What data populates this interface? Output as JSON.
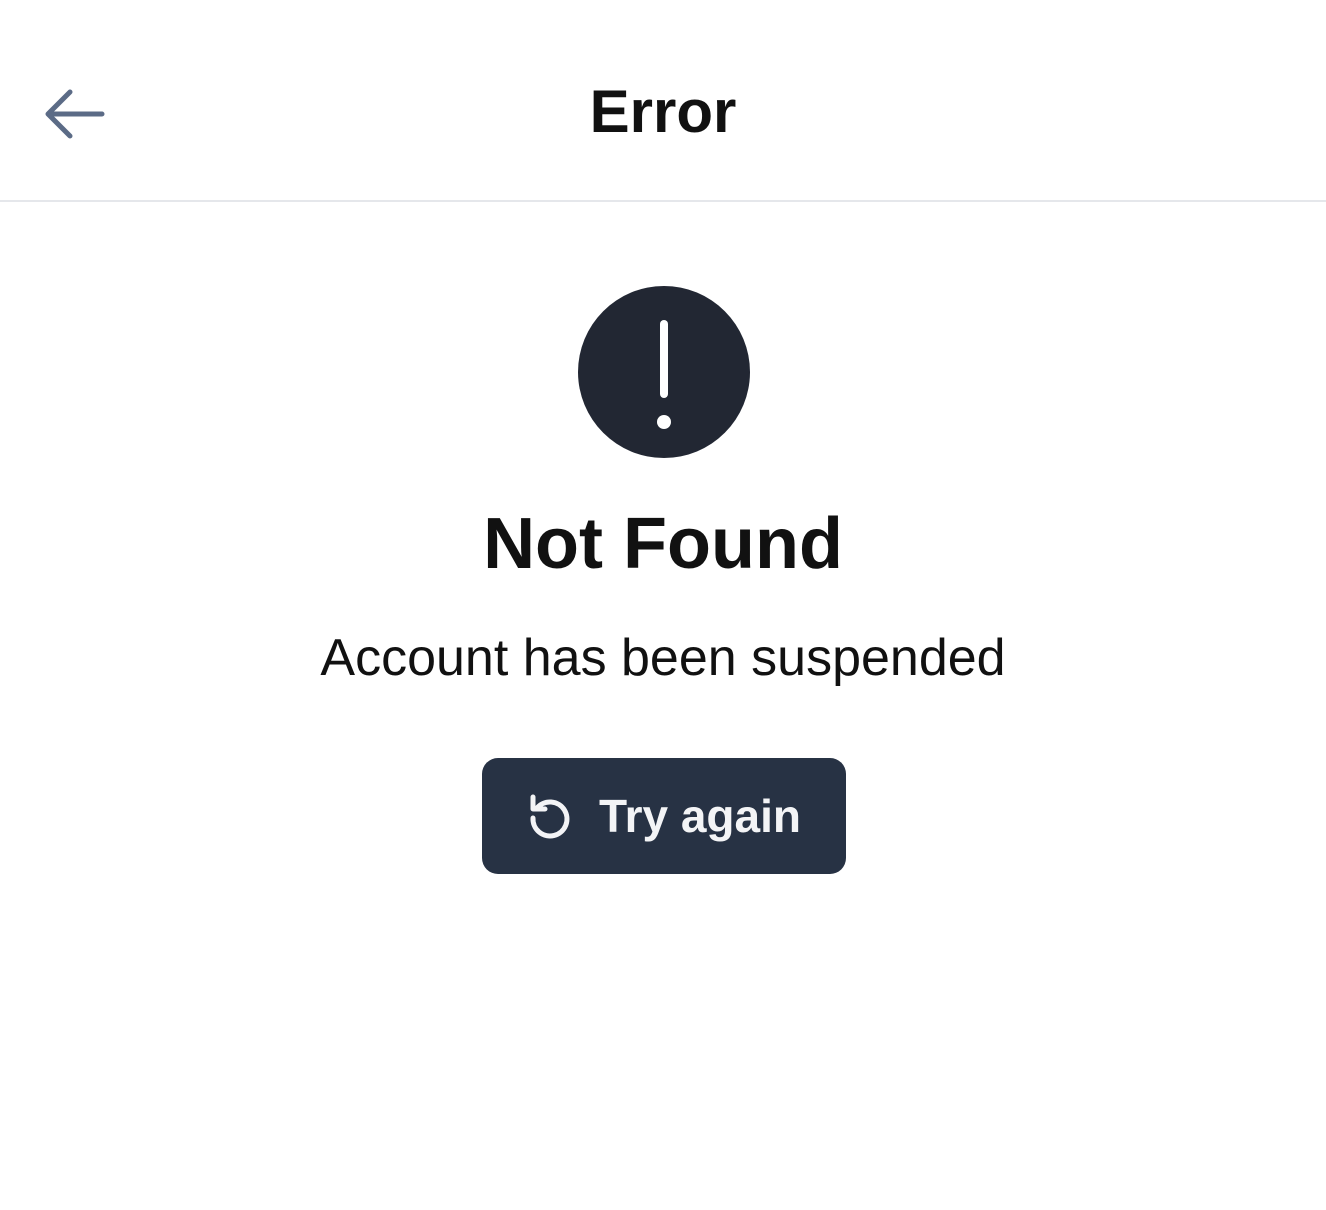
{
  "header": {
    "title": "Error",
    "back_icon": "arrow-left-icon"
  },
  "error": {
    "icon": "alert-exclamation-icon",
    "title": "Not Found",
    "message": "Account has been suspended"
  },
  "retry_button": {
    "label": "Try again",
    "icon": "refresh-icon"
  },
  "colors": {
    "back_arrow": "#5b6b86",
    "alert_circle": "#222733",
    "button_bg": "#273244",
    "divider": "#e5e7eb"
  }
}
